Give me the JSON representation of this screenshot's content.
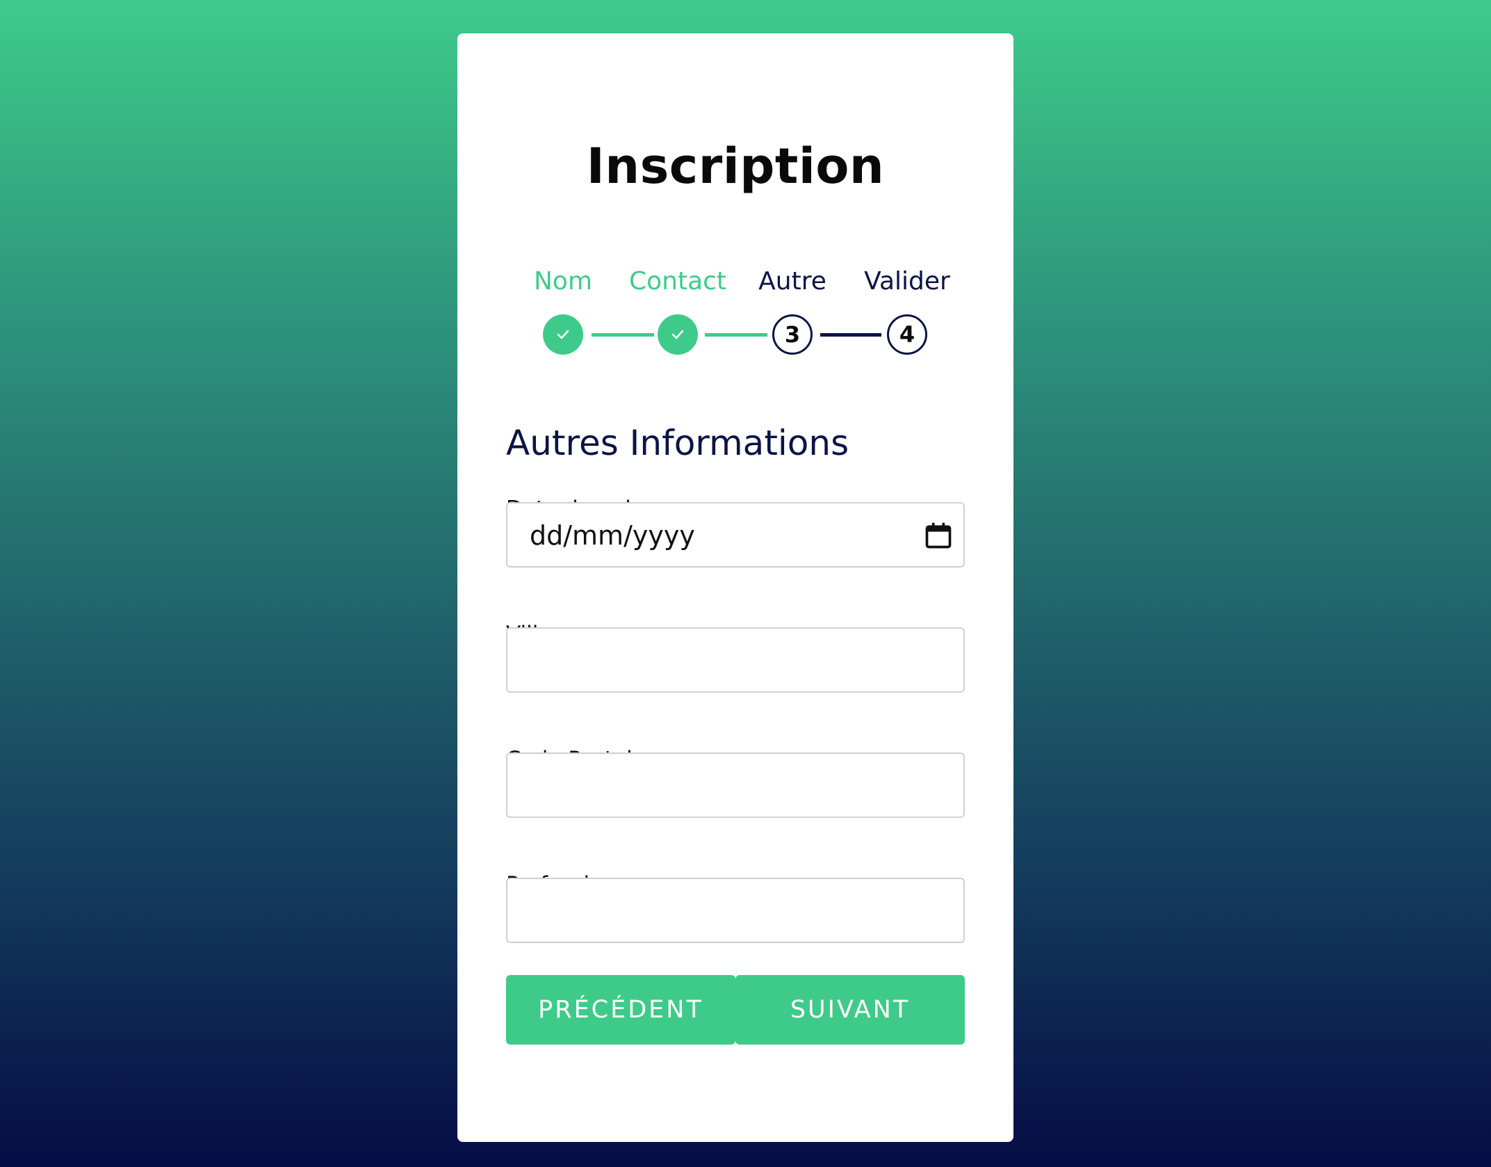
{
  "form": {
    "title": "Inscription",
    "section_title": "Autres Informations"
  },
  "steps": [
    {
      "label": "Nom",
      "state": "done",
      "icon": "check-icon"
    },
    {
      "label": "Contact",
      "state": "done",
      "icon": "check-icon"
    },
    {
      "label": "Autre",
      "state": "current",
      "number": "3"
    },
    {
      "label": "Valider",
      "state": "todo",
      "number": "4"
    }
  ],
  "fields": {
    "birthdate": {
      "label": "Date de naissance",
      "placeholder": "dd/mm/yyyy",
      "icon": "calendar-icon"
    },
    "city": {
      "label": "Ville",
      "value": ""
    },
    "postal_code": {
      "label": "Code Postal",
      "value": ""
    },
    "profession": {
      "label": "Profession",
      "value": ""
    }
  },
  "buttons": {
    "previous": "PRÉCÉDENT",
    "next": "SUIVANT"
  },
  "colors": {
    "accent": "#3ECB8A",
    "navy": "#0B1445",
    "background_top": "#3ECB8A",
    "background_bottom": "#060C45"
  }
}
